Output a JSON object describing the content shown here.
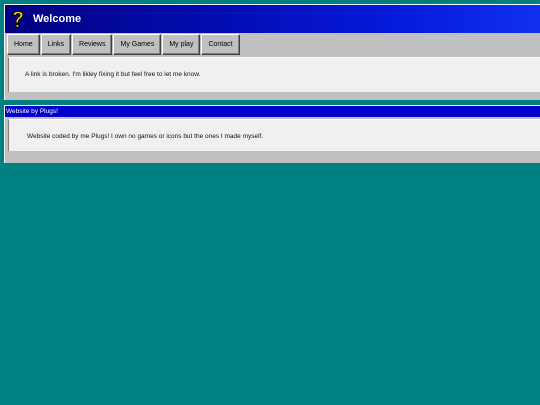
{
  "window": {
    "title": "Welcome",
    "title_icon": "question-mark-icon"
  },
  "nav": {
    "tabs": [
      {
        "label": "Home"
      },
      {
        "label": "Links"
      },
      {
        "label": "Reviews"
      },
      {
        "label": "My Games"
      },
      {
        "label": "My play"
      },
      {
        "label": "Contact"
      }
    ]
  },
  "main": {
    "message": "A link is broken. I'm likley fixing it but feel free to let me know."
  },
  "footer": {
    "title": "Website by Plugs!",
    "message": "Website coded by me Plugs! I own no games or icons but the ones I made myself."
  },
  "colors": {
    "desktop": "#008080",
    "titlebar": "#000080",
    "window": "#c0c0c0",
    "footer_bar": "#0000cc"
  }
}
